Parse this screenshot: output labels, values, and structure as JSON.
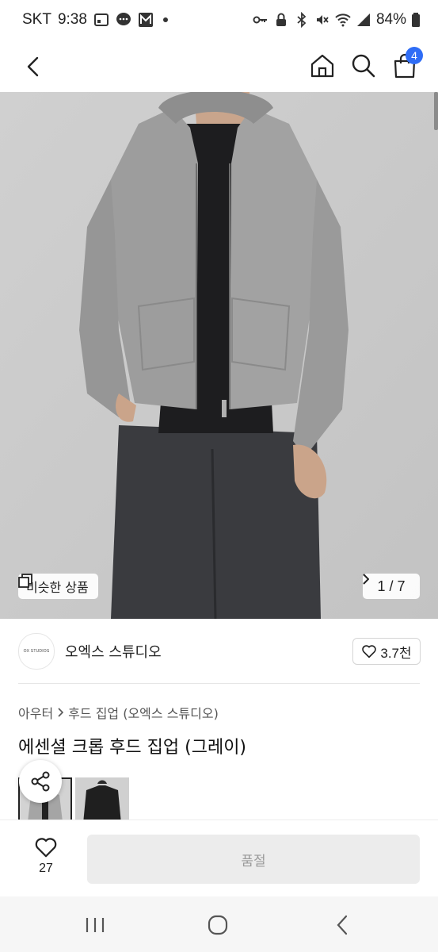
{
  "status_bar": {
    "carrier": "SKT",
    "time": "9:38",
    "battery": "84%",
    "left_icons": [
      "sim-card-icon",
      "chat-bubble-icon",
      "m-app-icon"
    ],
    "right_icons": [
      "key-icon",
      "lock-icon",
      "bluetooth-icon",
      "mute-icon",
      "wifi-icon",
      "signal-icon",
      "battery-icon"
    ]
  },
  "header": {
    "cart_count": "4",
    "icons": [
      "back-arrow-icon",
      "home-icon",
      "search-icon",
      "shopping-bag-icon"
    ]
  },
  "gallery": {
    "similar_label": "비슷한 상품",
    "pager": "1 / 7",
    "indicator_color": "#8b8b8b"
  },
  "store": {
    "logo_text": "OX STUDIOS",
    "name": "오엑스 스튜디오",
    "likes": "3.7천"
  },
  "product": {
    "breadcrumb": [
      "아우터",
      "후드 집업 (오엑스 스튜디오)"
    ],
    "title": "에센셜 크롭 후드 집업 (그레이)"
  },
  "bottom": {
    "wish_count": "27",
    "soldout_label": "품절"
  },
  "colors": {
    "accent": "#2f6df6",
    "disabled_bg": "#ececec",
    "disabled_text": "#9a9a9a"
  }
}
